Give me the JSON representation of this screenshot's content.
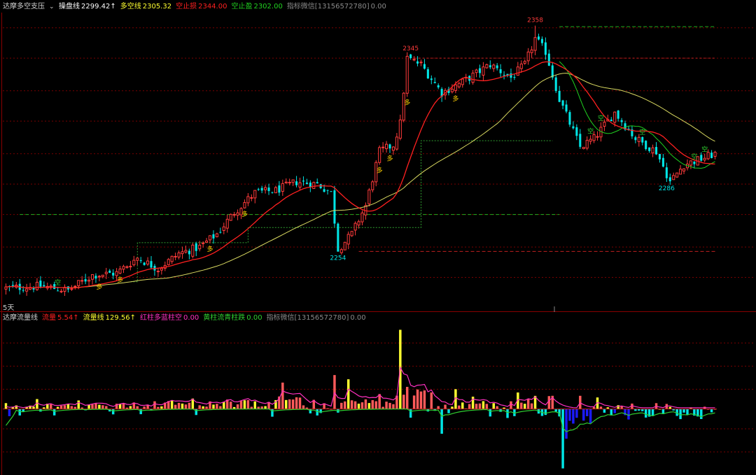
{
  "colors": {
    "up": "#ff3b3b",
    "down": "#00e5e5",
    "ma_fast": "#ff2020",
    "ma_slow": "#d8d860",
    "ma_mid": "#20d020",
    "grid": "#7a0000",
    "volume_yellow": "#ffff30",
    "volume_red": "#ff5a5a",
    "volume_cyan": "#00e5e5",
    "volume_blue": "#1b1bff",
    "magenta": "#ff30c0",
    "green_line": "#30d030"
  },
  "top_panel": {
    "indicator_name": "达摩多空支压",
    "items": [
      {
        "label": "操盘线",
        "value": "2299.42↑",
        "color": "#ffffff"
      },
      {
        "label": "多空线",
        "value": "2305.32",
        "color": "#ffff30"
      },
      {
        "label": "空止损",
        "value": "2344.00",
        "color": "#ff2020"
      },
      {
        "label": "空止盈",
        "value": "2302.00",
        "color": "#20d020"
      },
      {
        "label": "指标微信[13156572780]",
        "value": "0.00",
        "color": "#8a8a8a"
      }
    ],
    "period_label": "5天"
  },
  "bottom_panel": {
    "indicator_name": "达摩流量线",
    "items": [
      {
        "label": "流量",
        "value": "5.54↑",
        "color": "#ff2020"
      },
      {
        "label": "流量线",
        "value": "129.56↑",
        "color": "#ffff30"
      },
      {
        "label": "红柱多蓝柱空",
        "value": "0.00",
        "color": "#ff30c0"
      },
      {
        "label": "黄柱流青柱跌",
        "value": "0.00",
        "color": "#30d030"
      },
      {
        "label": "指标微信[13156572780]",
        "value": "0.00",
        "color": "#8a8a8a"
      }
    ]
  },
  "chart_data": {
    "type": "candlestick",
    "price_ylim": [
      2228,
      2364
    ],
    "price_labels": [
      {
        "text": "2358",
        "value": 2358,
        "index": 153,
        "pos": "above",
        "color": "#ff3b3b"
      },
      {
        "text": "2345",
        "value": 2345,
        "index": 117,
        "pos": "above",
        "color": "#ff3b3b"
      },
      {
        "text": "2254",
        "value": 2254,
        "index": 96,
        "pos": "below",
        "color": "#00e5e5"
      },
      {
        "text": "2286",
        "value": 2286,
        "index": 191,
        "pos": "below",
        "color": "#00e5e5"
      }
    ],
    "signal_mark_texts": {
      "buy": "多",
      "sell": "空"
    },
    "buy_marks": [
      27,
      33,
      59,
      69,
      108,
      111,
      116,
      130
    ],
    "sell_marks": [
      15,
      169,
      172,
      184,
      199,
      202
    ],
    "volume_ylim": [
      -20,
      26
    ]
  }
}
